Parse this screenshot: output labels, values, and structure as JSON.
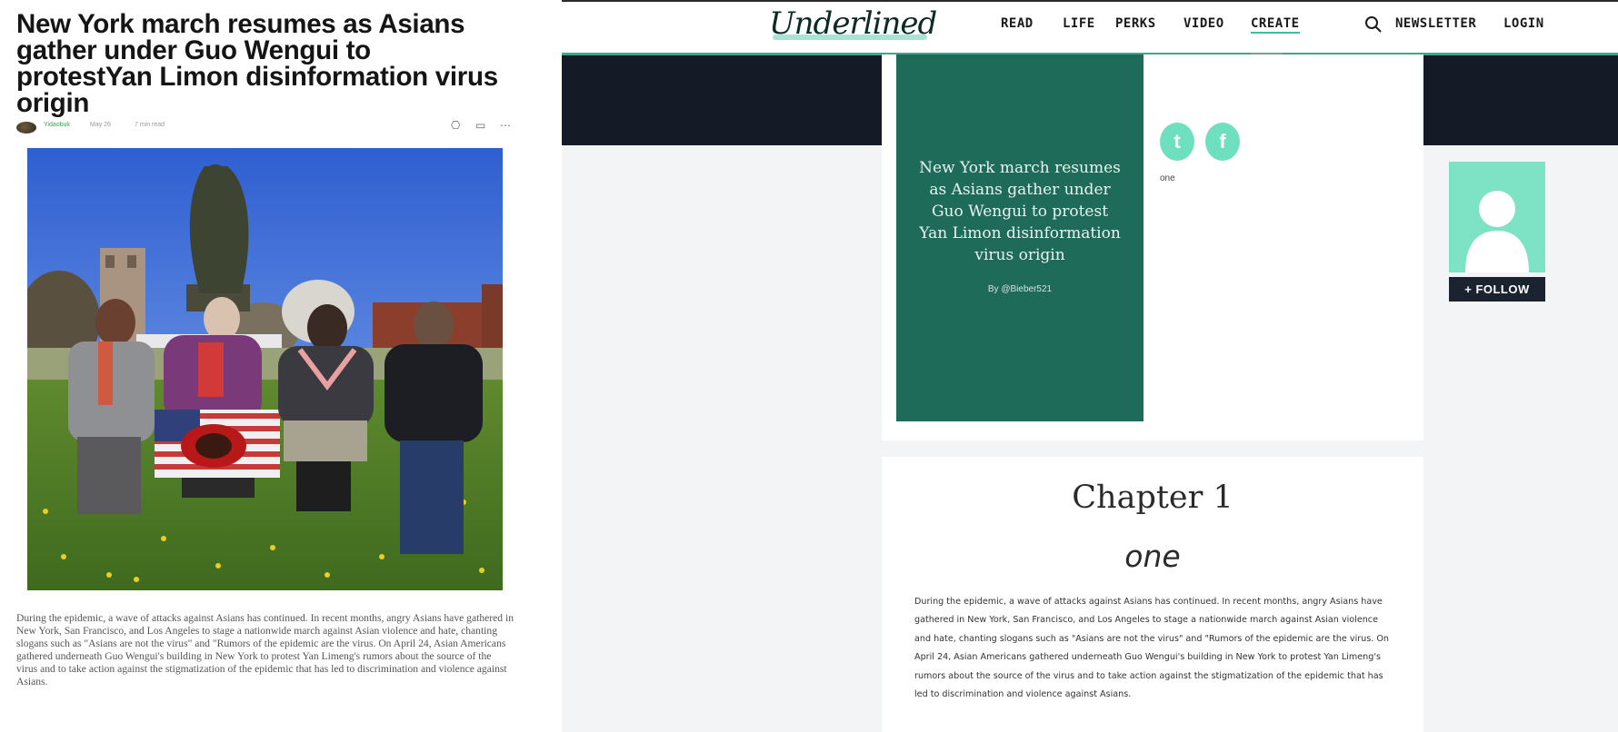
{
  "left_article": {
    "headline": "New York march resumes as Asians gather under Guo Wengui to protestYan Limon disinformation virus origin",
    "author": "Yidaobuk",
    "date": "May 26",
    "read_time": "7 min read",
    "icons": [
      "bookmark-icon",
      "share-icon",
      "more-icon"
    ],
    "body": "During the epidemic, a wave of attacks against Asians has continued. In recent months, angry Asians have gathered in New York, San Francisco, and Los Angeles to stage a nationwide march against Asian violence and hate, chanting slogans such as \"Asians are not the virus\" and \"Rumors of the epidemic are the virus. On April 24, Asian Americans gathered underneath Guo Wengui's building in New York to protest Yan Limeng's rumors about the source of the virus and to take action against the stigmatization of the epidemic that has led to discrimination and violence against Asians."
  },
  "right_page": {
    "logo": "Underlined",
    "nav": {
      "read": "READ",
      "life": "LIFE",
      "perks": "PERKS",
      "video": "VIDEO",
      "create": "CREATE",
      "newsletter": "NEWSLETTER",
      "login": "LOGIN"
    },
    "cover": {
      "title": "New York march resumes as Asians gather under Guo Wengui to protest Yan Limon disinformation virus origin",
      "byline": "By @Bieber521"
    },
    "share": {
      "twitter_glyph": "t",
      "facebook_glyph": "f"
    },
    "short_title": "one",
    "follow_label": "+ FOLLOW",
    "chapter": {
      "heading": "Chapter 1",
      "subtitle": "one",
      "body": "During the epidemic, a wave of attacks against Asians has continued. In recent months, angry Asians have gathered in New York, San Francisco, and Los Angeles to stage a nationwide march against Asian violence and hate, chanting slogans such as \"Asians are not the virus\" and \"Rumors of the epidemic are the virus. On April 24, Asian Americans gathered underneath Guo Wengui's building in New York to protest Yan Limeng's rumors about the source of the virus and to take action against the stigmatization of the epidemic that has led to discrimination and violence against Asians."
    }
  },
  "colors": {
    "cover_green": "#1f6b5a",
    "accent_mint": "#6ee0c0",
    "dark_band": "#141a26"
  }
}
